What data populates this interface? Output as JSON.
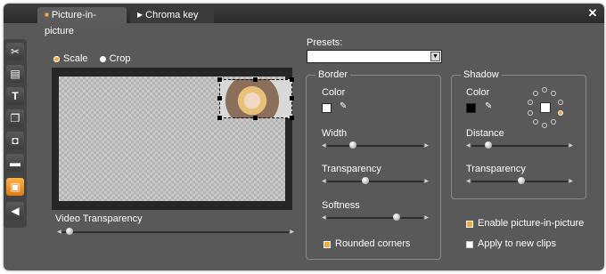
{
  "tabs": [
    {
      "label": "Picture-in-picture",
      "active": true,
      "icon": "checkbox-icon"
    },
    {
      "label": "Chroma key",
      "active": false,
      "icon": "play-triangle-icon"
    }
  ],
  "close_icon": "close-icon",
  "sidebar": {
    "items": [
      {
        "icon": "scissors-icon"
      },
      {
        "icon": "tools-icon"
      },
      {
        "icon": "title-T-icon"
      },
      {
        "icon": "layers-icon"
      },
      {
        "icon": "camera-icon"
      },
      {
        "icon": "clapperboard-icon"
      },
      {
        "icon": "pip-icon",
        "selected": true
      },
      {
        "icon": "audio-icon"
      }
    ]
  },
  "mode": {
    "options": [
      {
        "label": "Scale",
        "selected": true
      },
      {
        "label": "Crop",
        "selected": false
      }
    ]
  },
  "video_transparency": {
    "label": "Video Transparency",
    "value": 0.03
  },
  "presets": {
    "label": "Presets:",
    "value": ""
  },
  "border": {
    "title": "Border",
    "color_label": "Color",
    "color": "#ffffff",
    "width_label": "Width",
    "width_value": 0.27,
    "transparency_label": "Transparency",
    "transparency_value": 0.4,
    "softness_label": "Softness",
    "softness_value": 0.72,
    "rounded_corners_label": "Rounded corners",
    "rounded_corners_checked": true
  },
  "shadow": {
    "title": "Shadow",
    "color_label": "Color",
    "color": "#000000",
    "distance_label": "Distance",
    "distance_value": 0.18,
    "transparency_label": "Transparency",
    "transparency_value": 0.52,
    "direction": "bottom-right"
  },
  "enable_pip": {
    "label": "Enable picture-in-picture",
    "checked": true
  },
  "apply_new_clips": {
    "label": "Apply to new clips",
    "checked": false
  },
  "colors": {
    "accent": "#f3a93a",
    "panel": "#595959",
    "titlebar": "#2f2f2f"
  }
}
